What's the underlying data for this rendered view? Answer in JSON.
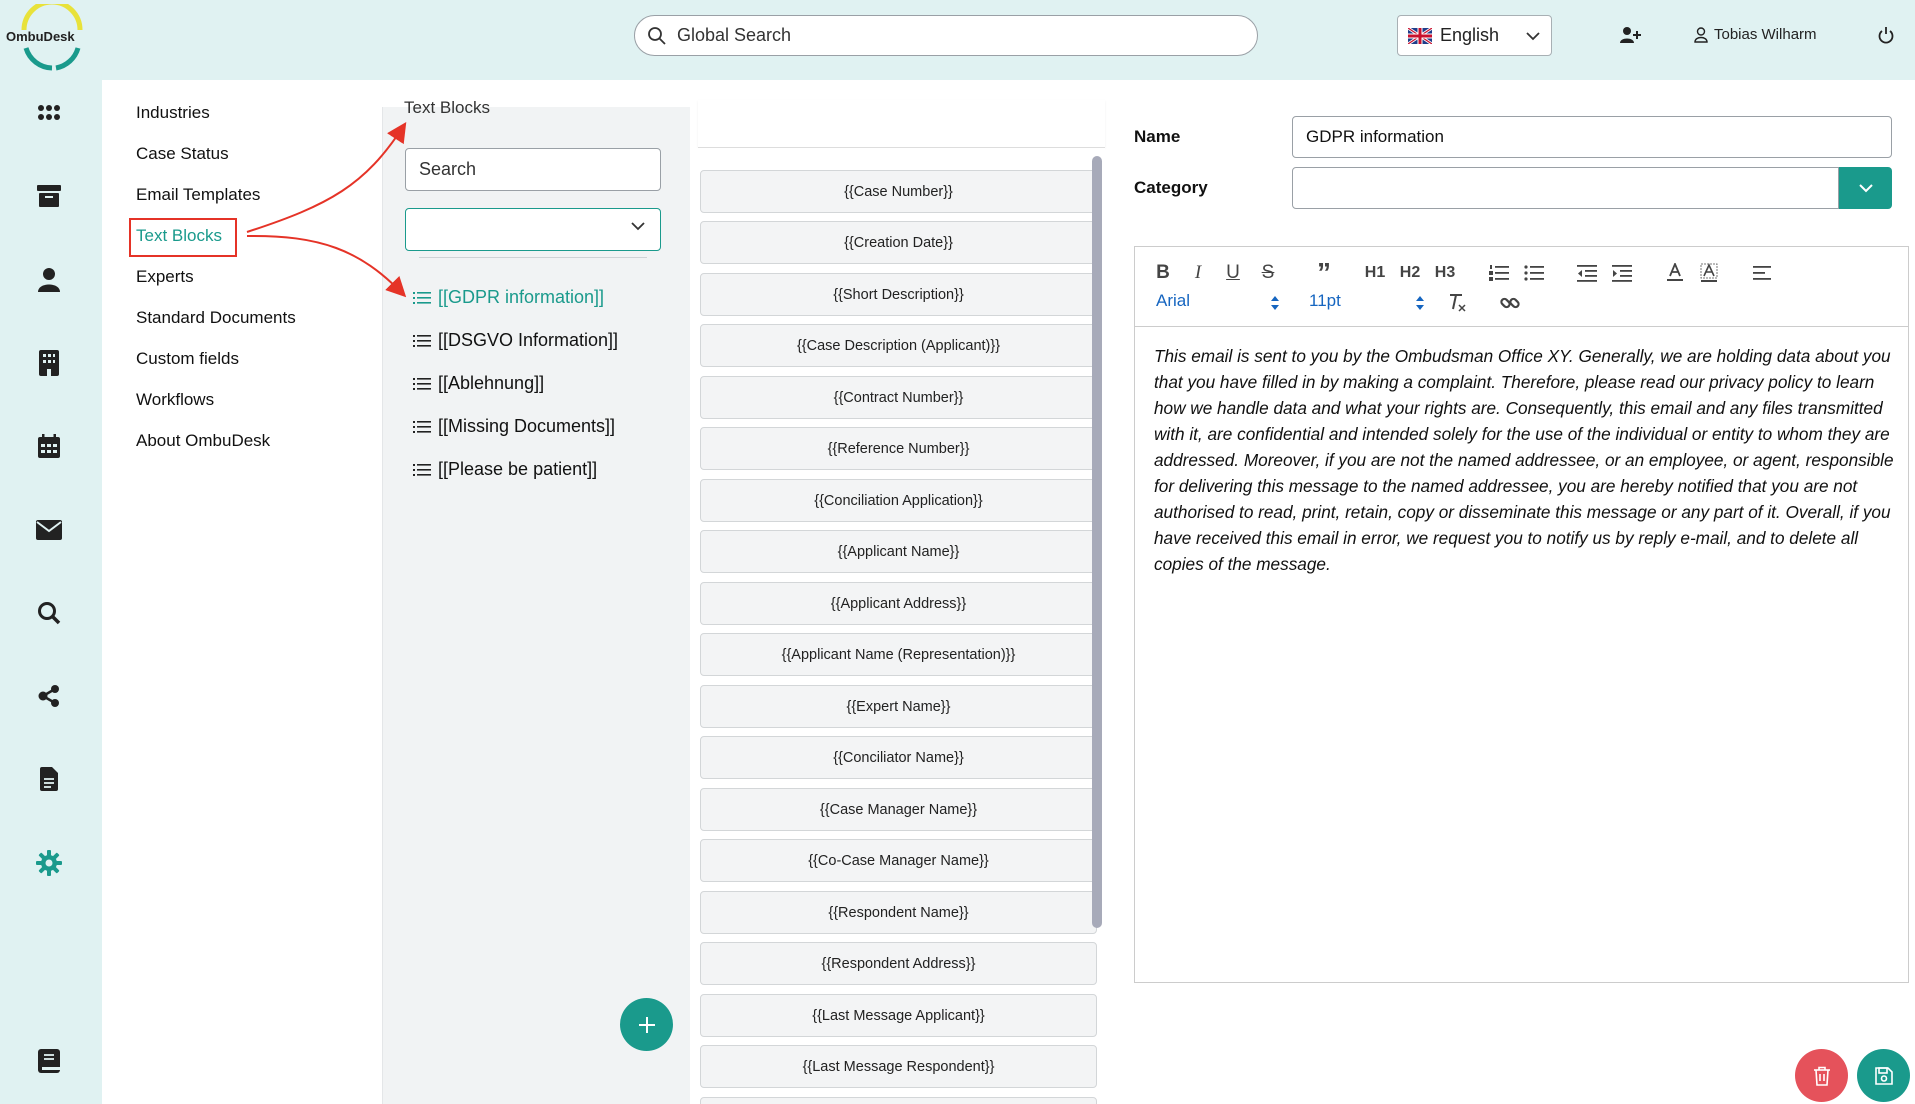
{
  "header": {
    "logo_text": "OmbuDesk",
    "search_placeholder": "Global Search",
    "language": "English",
    "user_name": "Tobias Wilharm"
  },
  "rail": {
    "icons": [
      "apps-grid-icon",
      "archive-icon",
      "person-icon",
      "building-icon",
      "calendar-icon",
      "mail-icon",
      "search-icon",
      "share-icon",
      "document-icon",
      "settings-gear-icon",
      "book-icon"
    ]
  },
  "settings_menu": {
    "items": [
      {
        "label": "Industries"
      },
      {
        "label": "Case Status"
      },
      {
        "label": "Email Templates"
      },
      {
        "label": "Text Blocks"
      },
      {
        "label": "Experts"
      },
      {
        "label": "Standard Documents"
      },
      {
        "label": "Custom fields"
      },
      {
        "label": "Workflows"
      },
      {
        "label": "About OmbuDesk"
      }
    ],
    "active": "Text Blocks"
  },
  "text_blocks": {
    "title": "Text Blocks",
    "search_placeholder": "Search",
    "category_selected": "",
    "items": [
      {
        "label": "[[GDPR information]]"
      },
      {
        "label": "[[DSGVO Information]]"
      },
      {
        "label": "[[Ablehnung]]"
      },
      {
        "label": "[[Missing Documents]]"
      },
      {
        "label": "[[Please be patient]]"
      }
    ],
    "active": "[[GDPR information]]"
  },
  "placeholders": [
    "{{Case Number}}",
    "{{Creation Date}}",
    "{{Short Description}}",
    "{{Case Description (Applicant)}}",
    "{{Contract Number}}",
    "{{Reference Number}}",
    "{{Conciliation Application}}",
    "{{Applicant Name}}",
    "{{Applicant Address}}",
    "{{Applicant Name (Representation)}}",
    "{{Expert Name}}",
    "{{Conciliator Name}}",
    "{{Case Manager Name}}",
    "{{Co-Case Manager Name}}",
    "{{Respondent Name}}",
    "{{Respondent Address}}",
    "{{Last Message Applicant}}",
    "{{Last Message Respondent}}"
  ],
  "editor": {
    "name_label": "Name",
    "name_value": "GDPR information",
    "category_label": "Category",
    "category_value": "",
    "toolbar": {
      "font": "Arial",
      "size": "11pt",
      "h1": "H1",
      "h2": "H2",
      "h3": "H3",
      "bold": "B",
      "italic": "I",
      "underline": "U",
      "strike": "S",
      "quote": "”"
    },
    "body": "This email is sent to you by the Ombudsman Office XY. Generally, we are holding data about you that you have filled in by making a complaint. Therefore, please read our privacy policy to learn how we handle data and what your rights are. Consequently, this email and any files transmitted with it, are confidential and intended solely for the use of the individual or entity to whom they are addressed. Moreover, if you are not the named addressee, or an employee, or agent, responsible for delivering this message to the named addressee, you are hereby notified that you are not authorised to read, print, retain, copy or disseminate this message or any part of it. Overall, if you have received this email in error, we request you to notify us by reply e-mail, and to delete all copies of the message."
  },
  "colors": {
    "accent": "#1a9a8c",
    "header_bg": "#e0f2f2",
    "annotation_red": "#e53327",
    "delete_red": "#e5525b"
  }
}
